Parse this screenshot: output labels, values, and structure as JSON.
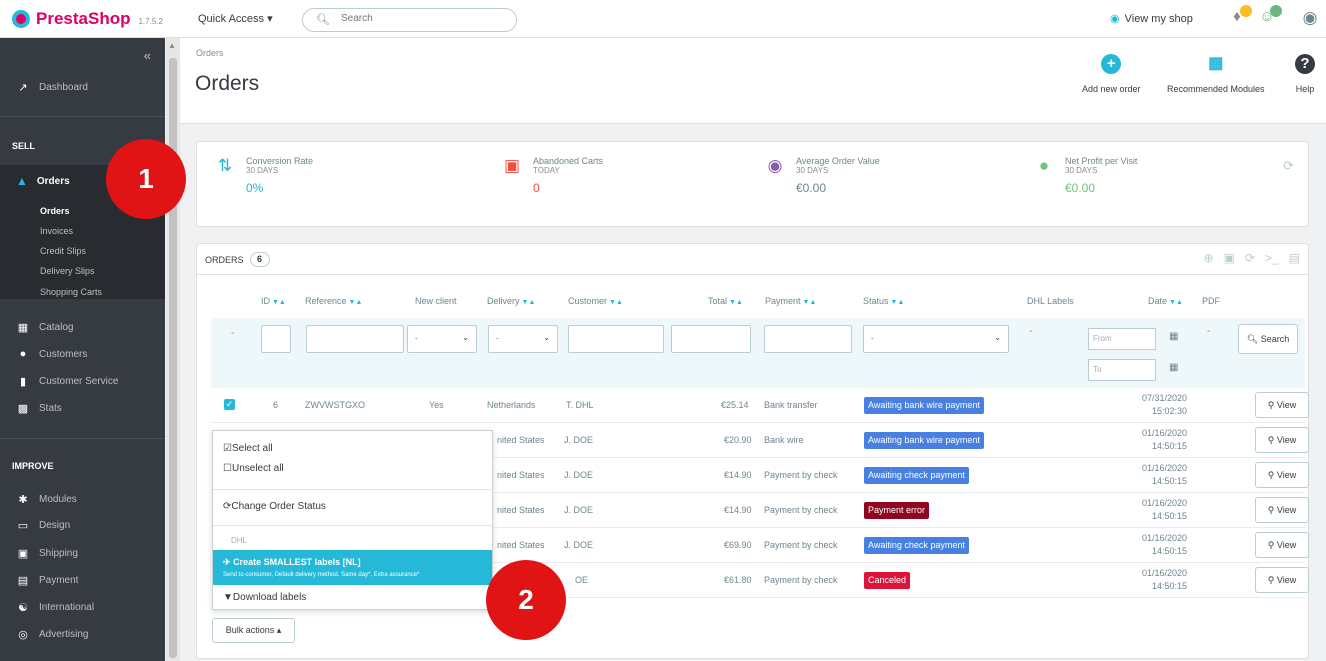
{
  "topbar": {
    "brand": "PrestaShop",
    "version": "1.7.5.2",
    "quick_access": "Quick Access ▾",
    "search_placeholder": "Search",
    "view_shop": "View my shop"
  },
  "sidebar": {
    "dashboard": "Dashboard",
    "sell_head": "SELL",
    "orders": "Orders",
    "orders_sub": [
      "Orders",
      "Invoices",
      "Credit Slips",
      "Delivery Slips",
      "Shopping Carts"
    ],
    "sell_items": [
      "Catalog",
      "Customers",
      "Customer Service",
      "Stats"
    ],
    "improve_head": "IMPROVE",
    "improve_items": [
      "Modules",
      "Design",
      "Shipping",
      "Payment",
      "International",
      "Advertising"
    ]
  },
  "header": {
    "breadcrumb": "Orders",
    "title": "Orders",
    "add_new_order": "Add new order",
    "recommended_modules": "Recommended Modules",
    "help": "Help"
  },
  "kpis": [
    {
      "label": "Conversion Rate",
      "period": "30 DAYS",
      "value": "0%",
      "color": "#25b9d7"
    },
    {
      "label": "Abandoned Carts",
      "period": "TODAY",
      "value": "0",
      "color": "#f54c3e"
    },
    {
      "label": "Average Order Value",
      "period": "30 DAYS",
      "value": "€0.00",
      "color": "#8a5da8"
    },
    {
      "label": "Net Profit per Visit",
      "period": "30 DAYS",
      "value": "€0.00",
      "color": "#72c279"
    }
  ],
  "orders_panel": {
    "title": "ORDERS",
    "count": "6",
    "columns": {
      "id": "ID",
      "reference": "Reference",
      "new_client": "New client",
      "delivery": "Delivery",
      "customer": "Customer",
      "total": "Total",
      "payment": "Payment",
      "status": "Status",
      "dhl_labels": "DHL Labels",
      "date": "Date",
      "pdf": "PDF"
    },
    "filters": {
      "select_dash": "-",
      "from_placeholder": "From",
      "to_placeholder": "To",
      "search_button": "Search"
    },
    "rows": [
      {
        "id": "6",
        "reference": "ZWVWSTGXO",
        "new_client": "Yes",
        "delivery": "Netherlands",
        "customer": "T. DHL",
        "total": "€25.14",
        "payment": "Bank transfer",
        "status": "Awaiting bank wire payment",
        "status_color": "#4880e1",
        "date": "07/31/2020",
        "time": "15:02:30",
        "view": "View"
      },
      {
        "delivery": "nited States",
        "customer": "J. DOE",
        "total": "€20.90",
        "payment": "Bank wire",
        "status": "Awaiting bank wire payment",
        "status_color": "#4880e1",
        "date": "01/16/2020",
        "time": "14:50:15",
        "view": "View"
      },
      {
        "delivery": "nited States",
        "customer": "J. DOE",
        "total": "€14.90",
        "payment": "Payment by check",
        "status": "Awaiting check payment",
        "status_color": "#4880e1",
        "date": "01/16/2020",
        "time": "14:50:15",
        "view": "View"
      },
      {
        "delivery": "nited States",
        "customer": "J. DOE",
        "total": "€14.90",
        "payment": "Payment by check",
        "status": "Payment error",
        "status_color": "#8f0621",
        "date": "01/16/2020",
        "time": "14:50:15",
        "view": "View"
      },
      {
        "delivery": "nited States",
        "customer": "J. DOE",
        "total": "€69.90",
        "payment": "Payment by check",
        "status": "Awaiting check payment",
        "status_color": "#4880e1",
        "date": "01/16/2020",
        "time": "14:50:15",
        "view": "View"
      },
      {
        "customer": "OE",
        "total": "€61.80",
        "payment": "Payment by check",
        "status": "Canceled",
        "status_color": "#dc143c",
        "date": "01/16/2020",
        "time": "14:50:15",
        "view": "View"
      }
    ]
  },
  "bulk_menu": {
    "select_all": "Select all",
    "unselect_all": "Unselect all",
    "change_status": "Change Order Status",
    "dhl_head": "DHL",
    "create_labels": "Create SMALLEST labels [NL]",
    "create_labels_desc": "Send to consumer, Default delivery method, Same day*, Extra assurance*",
    "download_labels": "Download labels",
    "button": "Bulk actions ▴"
  },
  "markers": [
    "1",
    "2"
  ],
  "colors": {
    "accent": "#25b9d7",
    "brand": "#df0067",
    "sidebar": "#363a41",
    "marker": "#e01414"
  }
}
